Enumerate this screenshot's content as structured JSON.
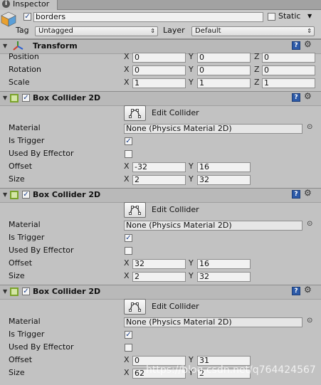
{
  "tab": {
    "label": "Inspector"
  },
  "object": {
    "active": true,
    "name": "borders",
    "static_label": "Static",
    "static_checked": false,
    "tag_label": "Tag",
    "tag_value": "Untagged",
    "layer_label": "Layer",
    "layer_value": "Default"
  },
  "transform": {
    "title": "Transform",
    "rows": [
      {
        "label": "Position",
        "x": "0",
        "y": "0",
        "z": "0"
      },
      {
        "label": "Rotation",
        "x": "0",
        "y": "0",
        "z": "0"
      },
      {
        "label": "Scale",
        "x": "1",
        "y": "1",
        "z": "1"
      }
    ],
    "axes": {
      "x": "X",
      "y": "Y",
      "z": "Z"
    }
  },
  "colliders": [
    {
      "title": "Box Collider 2D",
      "enabled": true,
      "edit_label": "Edit Collider",
      "material_label": "Material",
      "material_value": "None (Physics Material 2D)",
      "trigger_label": "Is Trigger",
      "trigger": true,
      "effector_label": "Used By Effector",
      "effector": false,
      "offset_label": "Offset",
      "offset_x": "-32",
      "offset_y": "16",
      "size_label": "Size",
      "size_x": "2",
      "size_y": "32"
    },
    {
      "title": "Box Collider 2D",
      "enabled": true,
      "edit_label": "Edit Collider",
      "material_label": "Material",
      "material_value": "None (Physics Material 2D)",
      "trigger_label": "Is Trigger",
      "trigger": true,
      "effector_label": "Used By Effector",
      "effector": false,
      "offset_label": "Offset",
      "offset_x": "32",
      "offset_y": "16",
      "size_label": "Size",
      "size_x": "2",
      "size_y": "32"
    },
    {
      "title": "Box Collider 2D",
      "enabled": true,
      "edit_label": "Edit Collider",
      "material_label": "Material",
      "material_value": "None (Physics Material 2D)",
      "trigger_label": "Is Trigger",
      "trigger": true,
      "effector_label": "Used By Effector",
      "effector": false,
      "offset_label": "Offset",
      "offset_x": "0",
      "offset_y": "31",
      "size_label": "Size",
      "size_x": "62",
      "size_y": "2"
    }
  ],
  "watermark": "https://blog.csdn.net/q764424567",
  "colors": {
    "panel": "#c2c2c2",
    "check": "#1a3f88",
    "help": "#2c5aa8",
    "collider_icon": "#7aa32a"
  }
}
